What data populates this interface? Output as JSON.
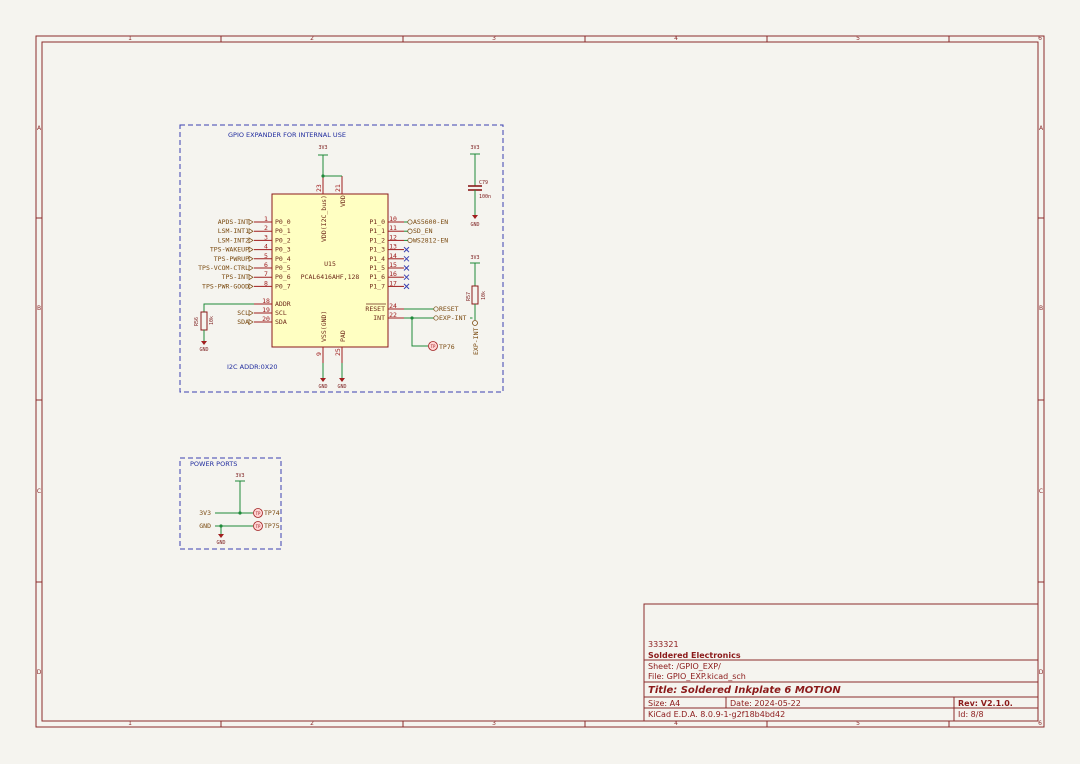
{
  "frame": {
    "columns": [
      "1",
      "2",
      "3",
      "4",
      "5",
      "6"
    ],
    "rows": [
      "A",
      "B",
      "C",
      "D"
    ]
  },
  "gpio_block": {
    "title": "GPIO EXPANDER FOR INTERNAL USE",
    "addr_note": "I2C ADDR:0X20",
    "chip": {
      "ref": "U15",
      "value": "PCAL6416AHF,128",
      "vdd_i2c": "VDD(I2C_bus)",
      "vdd": "VDD",
      "vss": "VSS(GND)",
      "pad": "PAD",
      "vdd_i2c_num": "23",
      "vdd_num": "21",
      "vss_num": "9",
      "pad_num": "25"
    },
    "left_pins": [
      {
        "num": "1",
        "name": "P0_0",
        "net": "APDS-INT"
      },
      {
        "num": "2",
        "name": "P0_1",
        "net": "LSM-INT1"
      },
      {
        "num": "3",
        "name": "P0_2",
        "net": "LSM-INT2"
      },
      {
        "num": "4",
        "name": "P0_3",
        "net": "TPS-WAKEUP"
      },
      {
        "num": "5",
        "name": "P0_4",
        "net": "TPS-PWRUP"
      },
      {
        "num": "6",
        "name": "P0_5",
        "net": "TPS-VCOM-CTRL"
      },
      {
        "num": "7",
        "name": "P0_6",
        "net": "TPS-INT"
      },
      {
        "num": "8",
        "name": "P0_7",
        "net": "TPS-PWR-GOOD"
      }
    ],
    "addr_pins": [
      {
        "num": "18",
        "name": "ADDR",
        "net": ""
      },
      {
        "num": "19",
        "name": "SCL",
        "net": "SCL"
      },
      {
        "num": "20",
        "name": "SDA",
        "net": "SDA"
      }
    ],
    "right_pins": [
      {
        "num": "10",
        "name": "P1_0",
        "net": "AS5600-EN"
      },
      {
        "num": "11",
        "name": "P1_1",
        "net": "SD_EN"
      },
      {
        "num": "12",
        "name": "P1_2",
        "net": "WS2812-EN"
      },
      {
        "num": "13",
        "name": "P1_3",
        "net": ""
      },
      {
        "num": "14",
        "name": "P1_4",
        "net": ""
      },
      {
        "num": "15",
        "name": "P1_5",
        "net": ""
      },
      {
        "num": "16",
        "name": "P1_6",
        "net": ""
      },
      {
        "num": "17",
        "name": "P1_7",
        "net": ""
      }
    ],
    "ctrl_pins": [
      {
        "num": "24",
        "name": "RESET",
        "net": "RESET"
      },
      {
        "num": "22",
        "name": "INT",
        "net": "EXP-INT"
      }
    ],
    "vdd_net": "3V3",
    "gnd_net": "GND",
    "cap": {
      "ref": "C79",
      "value": "100n"
    },
    "r_addr": {
      "ref": "R56",
      "value": "10k"
    },
    "r_int": {
      "ref": "R57",
      "value": "10k",
      "net": "EXP-INT"
    },
    "tp": "TP76"
  },
  "power_block": {
    "title": "POWER PORTS",
    "net_3v3": "3V3",
    "net_gnd": "GND",
    "tp1": "TP74",
    "tp2": "TP75",
    "tp_glyph": "TP"
  },
  "title_block": {
    "doc_no": "333321",
    "company": "Soldered Electronics",
    "sheet": "Sheet: /GPIO_EXP/",
    "file": "File: GPIO_EXP.kicad_sch",
    "title": "Title: Soldered Inkplate 6 MOTION",
    "size": "Size: A4",
    "date": "Date: 2024-05-22",
    "rev": "Rev: V2.1.0.",
    "tool": "KiCad E.D.A. 8.0.9-1-g2f18b4bd42",
    "id": "Id: 8/8"
  }
}
